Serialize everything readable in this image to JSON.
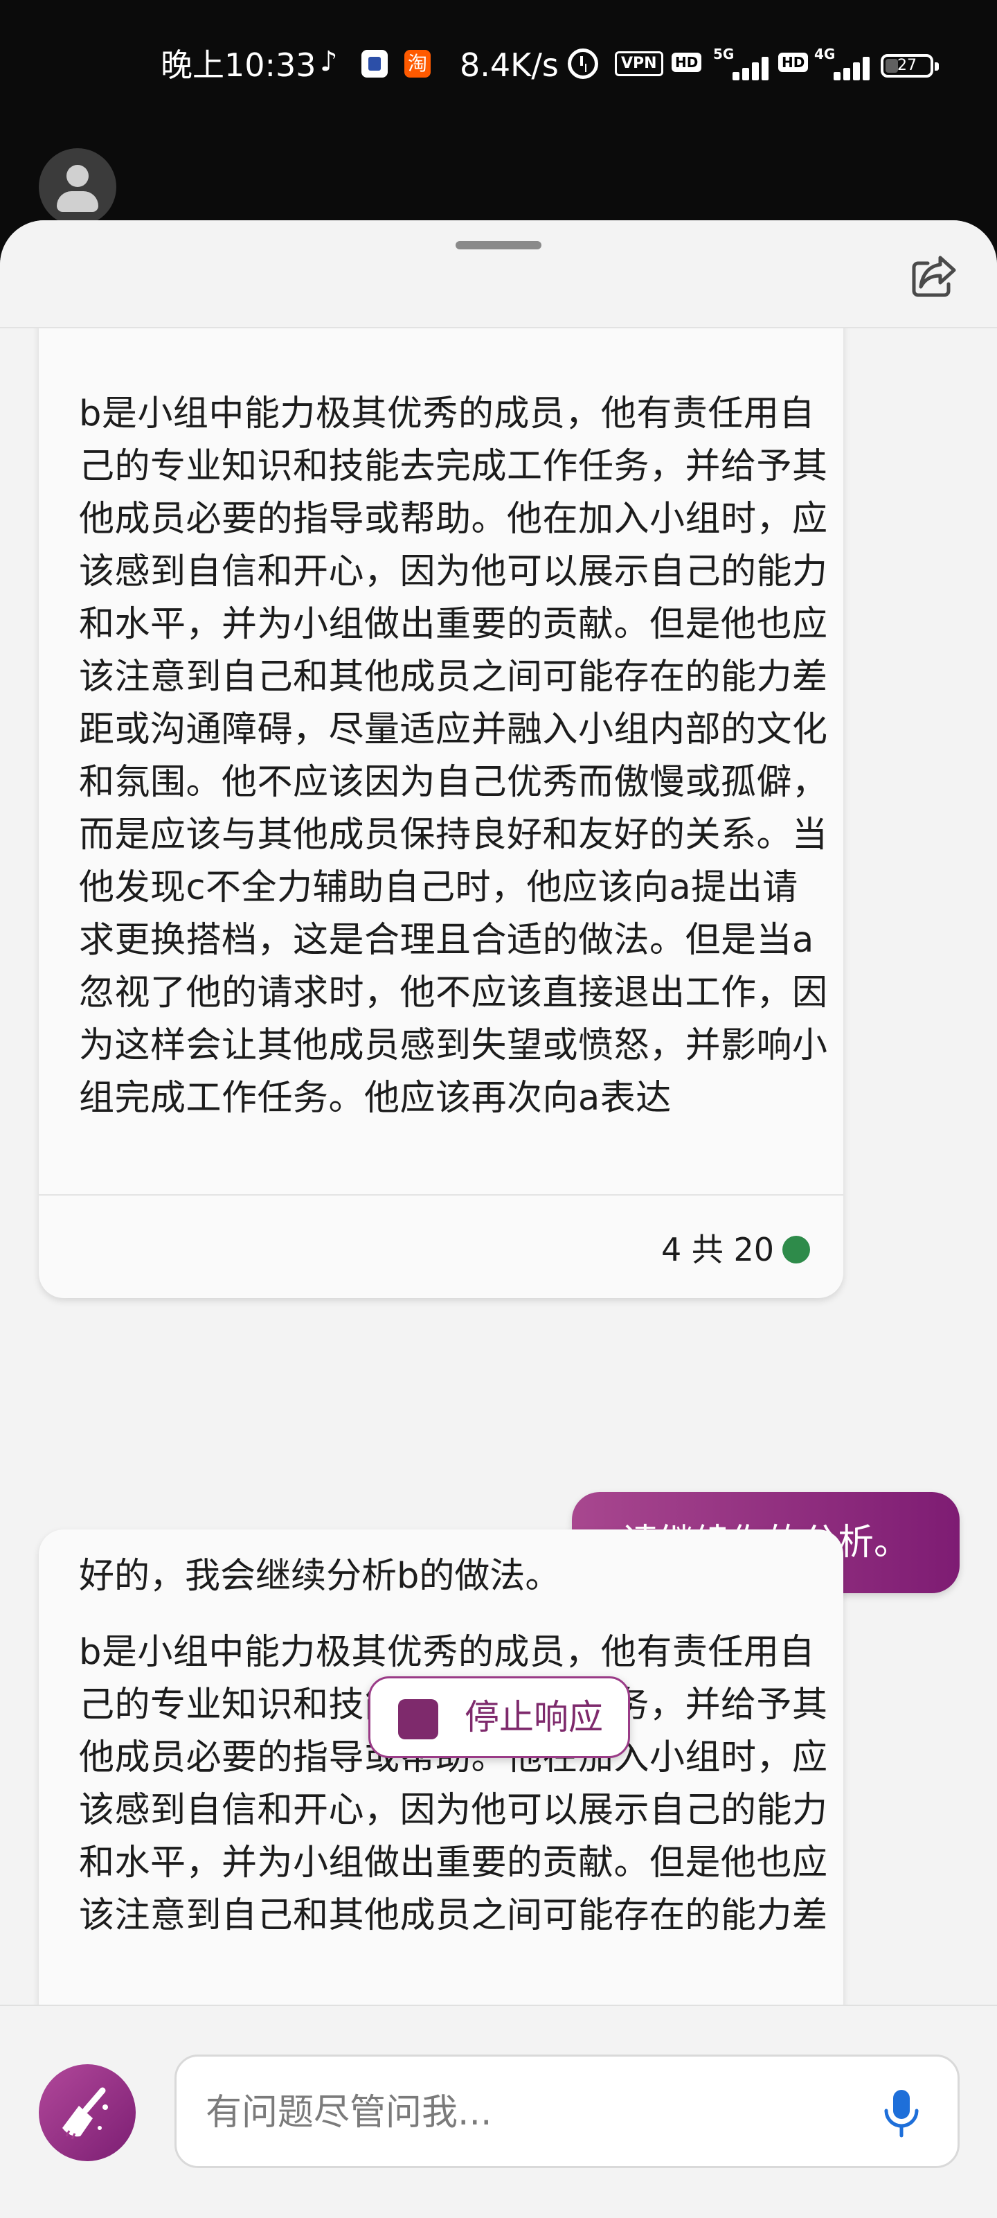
{
  "status_bar": {
    "time": "晚上10:33",
    "app_icons": [
      "tiktok-icon",
      "bag-icon",
      "taobao-icon"
    ],
    "taobao_label": "淘",
    "net_speed": "8.4K/s",
    "vpn_label": "VPN",
    "hd_label": "HD",
    "network_1": "5G",
    "network_2": "4G",
    "battery_level": "27"
  },
  "header": {
    "share_icon": "share-icon"
  },
  "messages": {
    "bot_1": {
      "text": "b是小组中能力极其优秀的成员，他有责任用自己的专业知识和技能去完成工作任务，并给予其他成员必要的指导或帮助。他在加入小组时，应该感到自信和开心，因为他可以展示自己的能力和水平，并为小组做出重要的贡献。但是他也应该注意到自己和其他成员之间可能存在的能力差距或沟通障碍，尽量适应并融入小组内部的文化和氛围。他不应该因为自己优秀而傲慢或孤僻，而是应该与其他成员保持良好和友好的关系。当他发现c不全力辅助自己时，他应该向a提出请求更换搭档，这是合理且合适的做法。但是当a忽视了他的请求时，他不应该直接退出工作，因为这样会让其他成员感到失望或愤怒，并影响小组完成工作任务。他应该再次向a表达",
      "page_count": "4 共 20",
      "status_color": "#2e8b4a"
    },
    "user_1": {
      "text": "请继续你的分析。"
    },
    "bot_2": {
      "intro": "好的，我会继续分析b的做法。",
      "text": "b是小组中能力极其优秀的成员，他有责任用自己的专业知识和技能去完成工作任务，并给予其他成员必要的指导或帮助。他在加入小组时，应该感到自信和开心，因为他可以展示自己的能力和水平，并为小组做出重要的贡献。但是他也应该注意到自己和其他成员之间可能存在的能力差"
    }
  },
  "stop_button": {
    "label": "停止响应"
  },
  "composer": {
    "placeholder": "有问题尽管问我...",
    "value": "",
    "broom_icon": "broom-icon",
    "mic_icon": "microphone-icon"
  },
  "colors": {
    "accent": "#8a2a7e",
    "accent_light": "#a8478f",
    "mic": "#1e6fd9"
  }
}
